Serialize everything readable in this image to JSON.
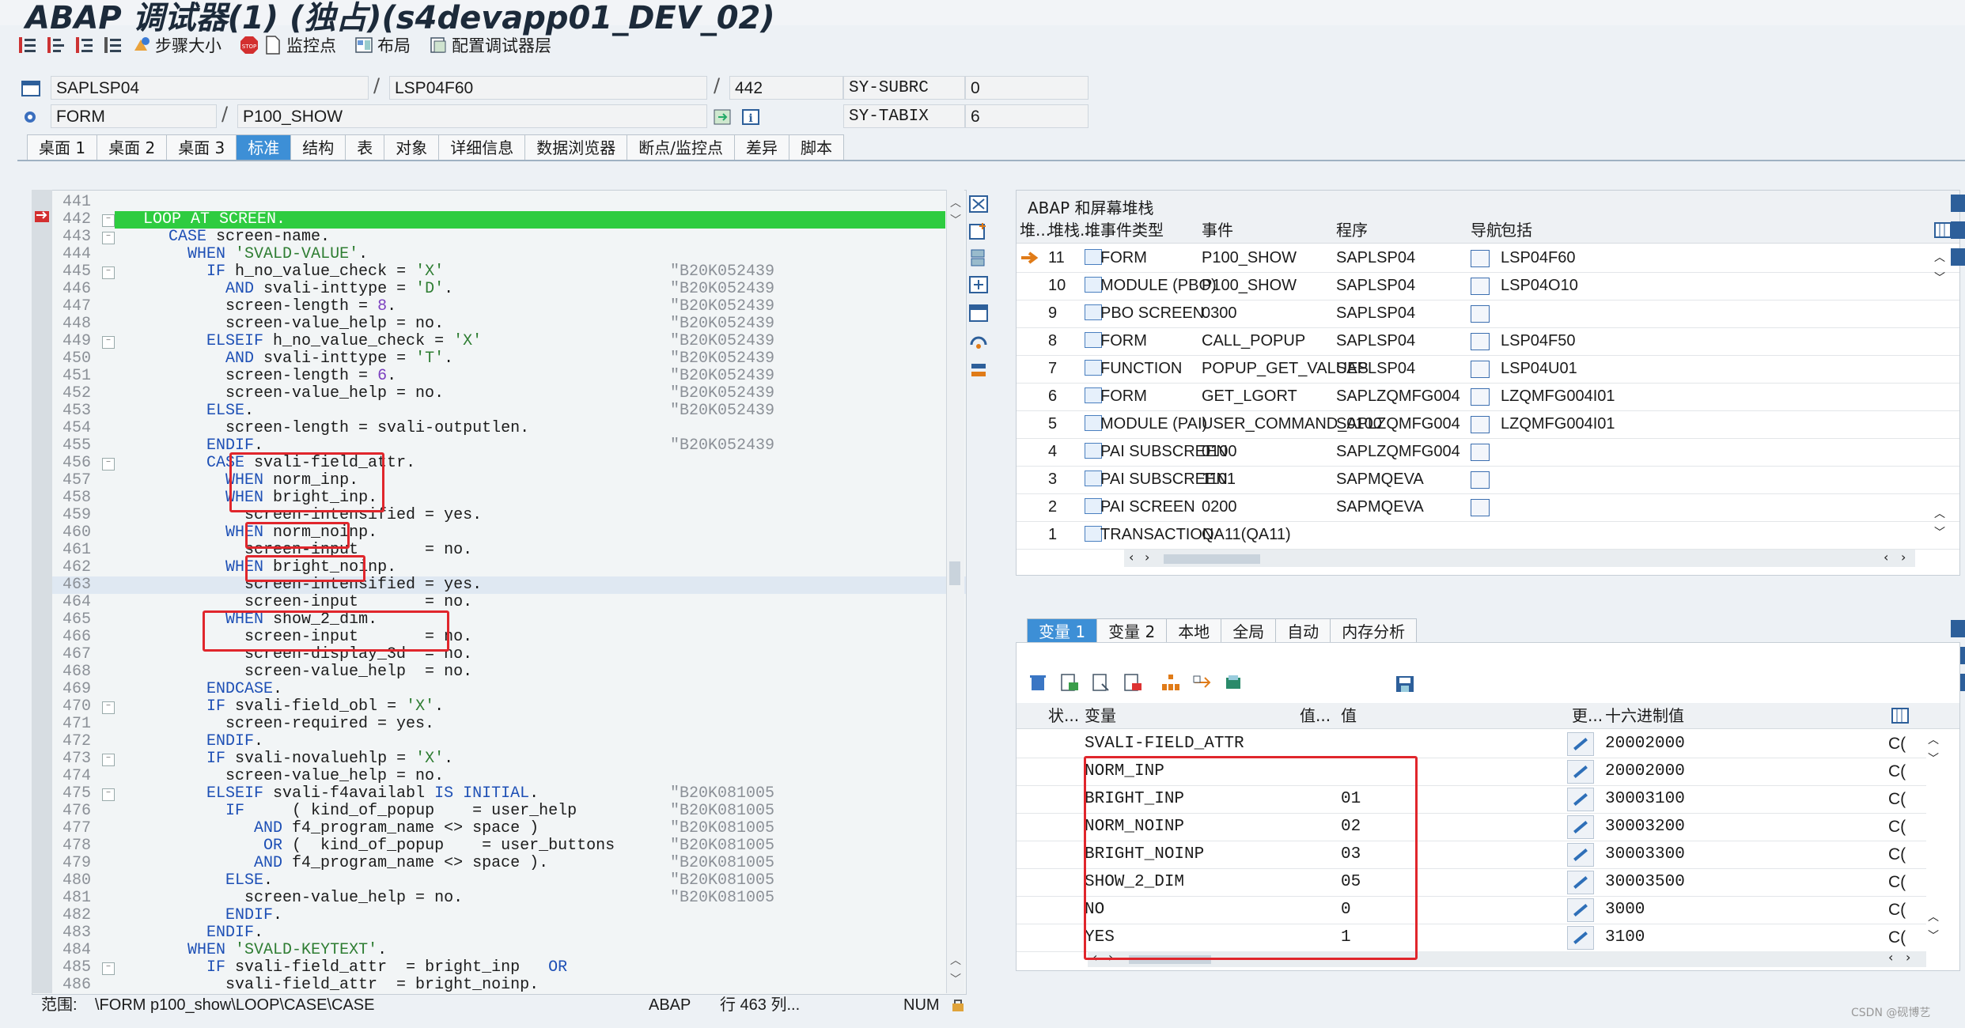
{
  "window": {
    "title": "ABAP 调试器(1) (独占)(s4devapp01_DEV_02)"
  },
  "toolbar": {
    "step_size": "步骤大小",
    "watchpoint": "监控点",
    "layout": "布局",
    "config": "配置调试器层"
  },
  "info": {
    "program": "SAPLSP04",
    "include": "LSP04F60",
    "line": "442",
    "subrc_label": "SY-SUBRC",
    "subrc_value": "0",
    "event_type": "FORM",
    "event": "P100_SHOW",
    "tabix_label": "SY-TABIX",
    "tabix_value": "6"
  },
  "tabs": [
    "桌面 1",
    "桌面 2",
    "桌面 3",
    "标准",
    "结构",
    "表",
    "对象",
    "详细信息",
    "数据浏览器",
    "断点/监控点",
    "差异",
    "脚本"
  ],
  "active_tab": "标准",
  "code": {
    "lines": [
      {
        "n": "441",
        "t": ""
      },
      {
        "n": "442",
        "t": "  LOOP AT SCREEN."
      },
      {
        "n": "443",
        "t": "    CASE screen-name."
      },
      {
        "n": "444",
        "t": "      WHEN 'SVALD-VALUE'."
      },
      {
        "n": "445",
        "t": "        IF h_no_value_check = 'X'",
        "c": "\"B20K052439"
      },
      {
        "n": "446",
        "t": "          AND svali-inttype = 'D'.",
        "c": "\"B20K052439"
      },
      {
        "n": "447",
        "t": "          screen-length = 8.",
        "c": "\"B20K052439"
      },
      {
        "n": "448",
        "t": "          screen-value_help = no.",
        "c": "\"B20K052439"
      },
      {
        "n": "449",
        "t": "        ELSEIF h_no_value_check = 'X'",
        "c": "\"B20K052439"
      },
      {
        "n": "450",
        "t": "          AND svali-inttype = 'T'.",
        "c": "\"B20K052439"
      },
      {
        "n": "451",
        "t": "          screen-length = 6.",
        "c": "\"B20K052439"
      },
      {
        "n": "452",
        "t": "          screen-value_help = no.",
        "c": "\"B20K052439"
      },
      {
        "n": "453",
        "t": "        ELSE.",
        "c": "\"B20K052439"
      },
      {
        "n": "454",
        "t": "          screen-length = svali-outputlen."
      },
      {
        "n": "455",
        "t": "        ENDIF.",
        "c": "\"B20K052439"
      },
      {
        "n": "456",
        "t": "        CASE svali-field_attr."
      },
      {
        "n": "457",
        "t": "          WHEN norm_inp."
      },
      {
        "n": "458",
        "t": "          WHEN bright_inp."
      },
      {
        "n": "459",
        "t": "            screen-intensified = yes."
      },
      {
        "n": "460",
        "t": "          WHEN norm_noinp."
      },
      {
        "n": "461",
        "t": "            screen-input       = no."
      },
      {
        "n": "462",
        "t": "          WHEN bright_noinp."
      },
      {
        "n": "463",
        "t": "            screen-intensified = yes."
      },
      {
        "n": "464",
        "t": "            screen-input       = no."
      },
      {
        "n": "465",
        "t": "          WHEN show_2_dim."
      },
      {
        "n": "466",
        "t": "            screen-input       = no."
      },
      {
        "n": "467",
        "t": "            screen-display_3d  = no."
      },
      {
        "n": "468",
        "t": "            screen-value_help  = no."
      },
      {
        "n": "469",
        "t": "        ENDCASE."
      },
      {
        "n": "470",
        "t": "        IF svali-field_obl = 'X'."
      },
      {
        "n": "471",
        "t": "          screen-required = yes."
      },
      {
        "n": "472",
        "t": "        ENDIF."
      },
      {
        "n": "473",
        "t": "        IF svali-novaluehlp = 'X'."
      },
      {
        "n": "474",
        "t": "          screen-value_help = no."
      },
      {
        "n": "475",
        "t": "        ELSEIF svali-f4availabl IS INITIAL.",
        "c": "\"B20K081005"
      },
      {
        "n": "476",
        "t": "          IF     ( kind_of_popup    = user_help",
        "c": "\"B20K081005"
      },
      {
        "n": "477",
        "t": "             AND f4_program_name <> space )",
        "c": "\"B20K081005"
      },
      {
        "n": "478",
        "t": "              OR (  kind_of_popup    = user_buttons",
        "c": "\"B20K081005"
      },
      {
        "n": "479",
        "t": "             AND f4_program_name <> space ).",
        "c": "\"B20K081005"
      },
      {
        "n": "480",
        "t": "          ELSE.",
        "c": "\"B20K081005"
      },
      {
        "n": "481",
        "t": "            screen-value_help = no.",
        "c": "\"B20K081005"
      },
      {
        "n": "482",
        "t": "          ENDIF."
      },
      {
        "n": "483",
        "t": "        ENDIF."
      },
      {
        "n": "484",
        "t": "      WHEN 'SVALD-KEYTEXT'."
      },
      {
        "n": "485",
        "t": "        IF svali-field_attr  = bright_inp   OR"
      },
      {
        "n": "486",
        "t": "          svali-field_attr  = bright_noinp."
      }
    ]
  },
  "status": {
    "scope_label": "范围:",
    "path": "\\FORM p100_show\\LOOP\\CASE\\CASE",
    "lang": "ABAP",
    "pos": "行 463 列...",
    "num": "NUM"
  },
  "stack": {
    "title": "ABAP 和屏幕堆栈",
    "headers": [
      "堆...",
      "堆栈...",
      "堆.",
      "事件类型",
      "事件",
      "程序",
      "导航",
      "包括"
    ],
    "rows": [
      {
        "level": "11",
        "type": "FORM",
        "event": "P100_SHOW",
        "program": "SAPLSP04",
        "include": "LSP04F60",
        "current": true,
        "nav": true
      },
      {
        "level": "10",
        "type": "MODULE (PBO)",
        "event": "P100_SHOW",
        "program": "SAPLSP04",
        "include": "LSP04O10",
        "nav": true
      },
      {
        "level": "9",
        "type": "PBO SCREEN",
        "event": "0300",
        "program": "SAPLSP04",
        "include": "",
        "nav": true
      },
      {
        "level": "8",
        "type": "FORM",
        "event": "CALL_POPUP",
        "program": "SAPLSP04",
        "include": "LSP04F50",
        "nav": true
      },
      {
        "level": "7",
        "type": "FUNCTION",
        "event": "POPUP_GET_VALUES",
        "program": "SAPLSP04",
        "include": "LSP04U01",
        "nav": true
      },
      {
        "level": "6",
        "type": "FORM",
        "event": "GET_LGORT",
        "program": "SAPLZQMFG004",
        "include": "LZQMFG004I01",
        "nav": true
      },
      {
        "level": "5",
        "type": "MODULE (PAI)",
        "event": "USER_COMMAND_0100",
        "program": "SAPLZQMFG004",
        "include": "LZQMFG004I01",
        "nav": true
      },
      {
        "level": "4",
        "type": "PAI SUBSCREEN",
        "event": "0100",
        "program": "SAPLZQMFG004",
        "include": "",
        "nav": true
      },
      {
        "level": "3",
        "type": "PAI SUBSCREEN",
        "event": "1101",
        "program": "SAPMQEVA",
        "include": "",
        "nav": true
      },
      {
        "level": "2",
        "type": "PAI SCREEN",
        "event": "0200",
        "program": "SAPMQEVA",
        "include": "",
        "nav": true
      },
      {
        "level": "1",
        "type": "TRANSACTION",
        "event": "QA11(QA11)",
        "program": "",
        "include": "",
        "nav": false
      }
    ]
  },
  "vartabs": [
    "变量 1",
    "变量 2",
    "本地",
    "全局",
    "自动",
    "内存分析"
  ],
  "vars": {
    "headers": [
      "状...",
      "变量",
      "值...",
      "值",
      "更...",
      "十六进制值"
    ],
    "rows": [
      {
        "name": "SVALI-FIELD_ATTR",
        "value": "",
        "hex": "20002000",
        "tail": "C("
      },
      {
        "name": "NORM_INP",
        "value": "",
        "hex": "20002000",
        "tail": "C("
      },
      {
        "name": "BRIGHT_INP",
        "value": "01",
        "hex": "30003100",
        "tail": "C("
      },
      {
        "name": "NORM_NOINP",
        "value": "02",
        "hex": "30003200",
        "tail": "C("
      },
      {
        "name": "BRIGHT_NOINP",
        "value": "03",
        "hex": "30003300",
        "tail": "C("
      },
      {
        "name": "SHOW_2_DIM",
        "value": "05",
        "hex": "30003500",
        "tail": "C("
      },
      {
        "name": "NO",
        "value": "0",
        "hex": "3000",
        "tail": "C("
      },
      {
        "name": "YES",
        "value": "1",
        "hex": "3100",
        "tail": "C("
      }
    ]
  },
  "watermark": "CSDN @砚博艺",
  "colors": {
    "accent": "#3d8fd6",
    "current_line": "#2ecc40",
    "annotation": "#e0262c"
  }
}
